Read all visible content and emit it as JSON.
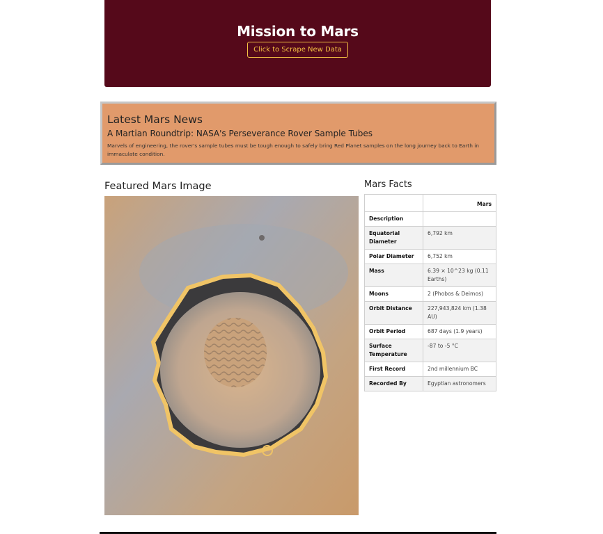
{
  "header": {
    "title": "Mission to Mars",
    "scrape_button": "Click to Scrape New Data"
  },
  "news": {
    "section_title": "Latest Mars News",
    "headline": "A Martian Roundtrip: NASA's Perseverance Rover Sample Tubes",
    "teaser": "Marvels of engineering, the rover's sample tubes must be tough enough to safely bring Red Planet samples on the long journey back to Earth in immaculate condition."
  },
  "featured": {
    "title": "Featured Mars Image"
  },
  "facts": {
    "title": "Mars Facts",
    "column_header": "Mars",
    "rows": [
      {
        "label": "Description",
        "value": ""
      },
      {
        "label": "Equatorial Diameter",
        "value": "6,792 km"
      },
      {
        "label": "Polar Diameter",
        "value": "6,752 km"
      },
      {
        "label": "Mass",
        "value": "6.39 × 10^23 kg (0.11 Earths)"
      },
      {
        "label": "Moons",
        "value": "2 (Phobos & Deimos)"
      },
      {
        "label": "Orbit Distance",
        "value": "227,943,824 km (1.38 AU)"
      },
      {
        "label": "Orbit Period",
        "value": "687 days (1.9 years)"
      },
      {
        "label": "Surface Temperature",
        "value": "-87 to -5 °C"
      },
      {
        "label": "First Record",
        "value": "2nd millennium BC"
      },
      {
        "label": "Recorded By",
        "value": "Egyptian astronomers"
      }
    ]
  },
  "colors": {
    "header_bg": "#55091a",
    "button_accent": "#f5c243",
    "news_bg": "#e19a6b"
  }
}
